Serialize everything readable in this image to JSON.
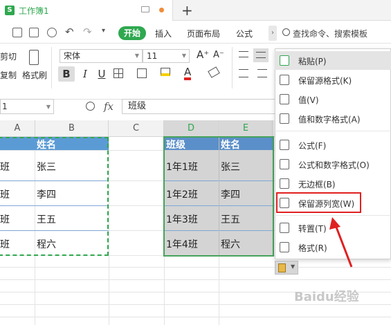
{
  "titlebar": {
    "doc_title": "工作簿1",
    "new_tab": "+"
  },
  "toolbar": {
    "start": "开始",
    "tabs": [
      "插入",
      "页面布局",
      "公式"
    ],
    "more": "›",
    "search": "查找命令、搜索模板"
  },
  "ribbon": {
    "cut": "剪切",
    "copy": "复制",
    "format_painter": "格式刷",
    "font_name": "宋体",
    "font_size": "11",
    "grow": "A⁺",
    "shrink": "A⁻",
    "bold": "B",
    "italic": "I",
    "underline": "U"
  },
  "formula_bar": {
    "name_box": "1",
    "fx": "fx",
    "value": "班级"
  },
  "columns": [
    {
      "label": "A",
      "selected": false
    },
    {
      "label": "B",
      "selected": false
    },
    {
      "label": "C",
      "selected": false
    },
    {
      "label": "D",
      "selected": true
    },
    {
      "label": "E",
      "selected": true
    }
  ],
  "table_ab": {
    "header": [
      "",
      "姓名"
    ],
    "rows": [
      [
        "班",
        "张三"
      ],
      [
        "班",
        "李四"
      ],
      [
        "班",
        "王五"
      ],
      [
        "班",
        "程六"
      ]
    ]
  },
  "table_de": {
    "header": [
      "班级",
      "姓名"
    ],
    "rows": [
      [
        "1年1班",
        "张三"
      ],
      [
        "1年2班",
        "李四"
      ],
      [
        "1年3班",
        "王五"
      ],
      [
        "1年4班",
        "程六"
      ]
    ]
  },
  "context_menu": {
    "items": [
      {
        "label": "粘贴(P)",
        "icon": "clipboard-icon"
      },
      {
        "label": "保留源格式(K)",
        "icon": "paste-format-icon"
      },
      {
        "label": "值(V)",
        "icon": "paste-values-icon"
      },
      {
        "label": "值和数字格式(A)",
        "icon": "paste-values-number-icon"
      },
      {
        "label": "公式(F)",
        "icon": "paste-formula-icon"
      },
      {
        "label": "公式和数字格式(O)",
        "icon": "paste-formula-number-icon"
      },
      {
        "label": "无边框(B)",
        "icon": "paste-no-border-icon"
      },
      {
        "label": "保留源列宽(W)",
        "icon": "paste-column-width-icon"
      },
      {
        "label": "转置(T)",
        "icon": "transpose-icon"
      },
      {
        "label": "格式(R)",
        "icon": "paste-format-only-icon"
      }
    ],
    "highlighted": "保留源列宽(W)"
  },
  "colors": {
    "accent": "#2fa84f",
    "header_blue": "#5b9bd5",
    "annotation_red": "#e02020"
  },
  "watermark": "Baidu经验"
}
